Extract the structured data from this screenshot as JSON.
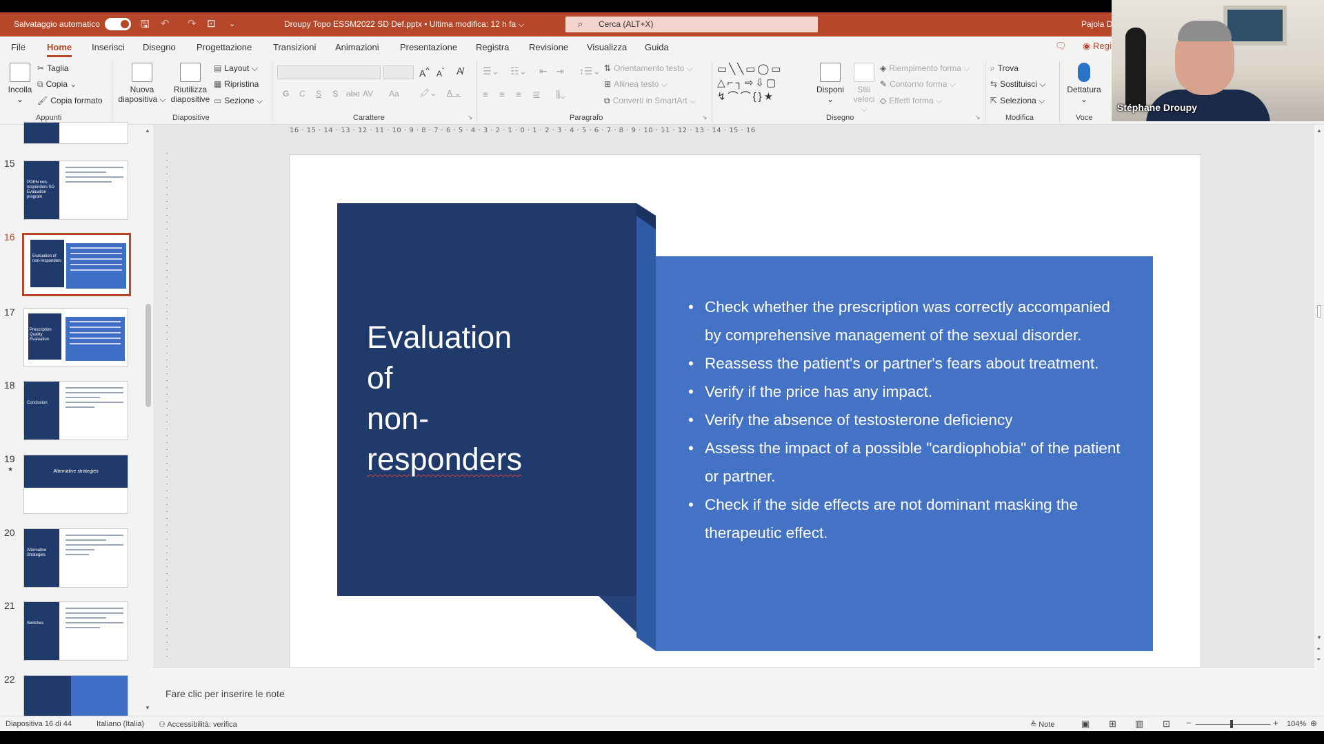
{
  "titlebar": {
    "autosave_label": "Salvataggio automatico",
    "document_title": "Droupy Topo ESSM2022 SD Def.pptx  •  Ultima modifica: 12 h fa ⌵",
    "search_placeholder": "Cerca (ALT+X)",
    "user_short": "Pajola D"
  },
  "tabs": [
    "File",
    "Home",
    "Inserisci",
    "Disegno",
    "Progettazione",
    "Transizioni",
    "Animazioni",
    "Presentazione",
    "Registra",
    "Revisione",
    "Visualizza",
    "Guida"
  ],
  "active_tab": "Home",
  "tab_right": {
    "record": "Regi"
  },
  "ribbon": {
    "appunti": {
      "paste": "Incolla",
      "cut": "Taglia",
      "copy": "Copia",
      "format_painter": "Copia formato",
      "group": "Appunti"
    },
    "diapositive": {
      "new_slide_1": "Nuova",
      "new_slide_2": "diapositiva ⌵",
      "reuse_1": "Riutilizza",
      "reuse_2": "diapositive",
      "layout": "Layout ⌵",
      "reset": "Ripristina",
      "section": "Sezione ⌵",
      "group": "Diapositive"
    },
    "carattere": {
      "group": "Carattere",
      "bold": "G",
      "italic": "C",
      "underline": "S",
      "strike": "S",
      "abc": "abc",
      "spacing": "AV",
      "case": "Aa",
      "grow": "A",
      "shrink": "A"
    },
    "paragrafo": {
      "group": "Paragrafo",
      "text_direction": "Orientamento testo ⌵",
      "align_text": "Allinea testo ⌵",
      "smartart": "Converti in SmartArt ⌵"
    },
    "disegno": {
      "group": "Disegno",
      "arrange": "Disponi",
      "styles_1": "Stili",
      "styles_2": "veloci ⌵",
      "fill": "Riempimento forma ⌵",
      "outline": "Contorno forma ⌵",
      "effects": "Effetti forma ⌵"
    },
    "modifica": {
      "group": "Modifica",
      "find": "Trova",
      "replace": "Sostituisci ⌵",
      "select": "Seleziona ⌵"
    },
    "voce": {
      "dictate": "Dettatura",
      "group": "Voce"
    }
  },
  "webcam": {
    "name": "Stéphane Droupy"
  },
  "ruler_h": "16 · 15 · 14 · 13 · 12 · 11 · 10 · 9 · 8 · 7 · 6 · 5 · 4 · 3 · 2 · 1 · 0 · 1 · 2 · 3 · 4 · 5 · 6 · 7 · 8 · 9 · 10 · 11 · 12 · 13 · 14 · 15 · 16",
  "thumbnails": [
    {
      "num": "15",
      "label": "PDE5i non-responders SD Evaluation program"
    },
    {
      "num": "16",
      "label": "Evaluation of non-responders"
    },
    {
      "num": "17",
      "label": "Prescription Quality Evaluation"
    },
    {
      "num": "18",
      "label": "Conclusion"
    },
    {
      "num": "19",
      "label": "Alternative strategies",
      "star": "★"
    },
    {
      "num": "20",
      "label": "Alternative Strategies"
    },
    {
      "num": "21",
      "label": "Switches"
    },
    {
      "num": "22",
      "label": ""
    }
  ],
  "slide": {
    "title_lines": [
      "Evaluation",
      "of",
      "non-",
      "responders"
    ],
    "bullets": [
      "Check whether the prescription was correctly accompanied by comprehensive management of the sexual disorder.",
      "Reassess the patient's or partner's fears about treatment.",
      "Verify if the price has any impact.",
      "Verify the absence of testosterone deficiency",
      "Assess the impact of a possible \"cardiophobia\" of the patient or partner.",
      "Check if the side effects are not dominant masking the therapeutic effect."
    ]
  },
  "notes_placeholder": "Fare clic per inserire le note",
  "status": {
    "slide_counter": "Diapositiva 16 di 44",
    "language": "Italiano (Italia)",
    "accessibility": "Accessibilità: verifica",
    "notes": "Note",
    "zoom": "104%"
  },
  "colors": {
    "accent": "#b7472a",
    "slide_dark": "#1f3a6b",
    "slide_blue": "#4472c4"
  }
}
